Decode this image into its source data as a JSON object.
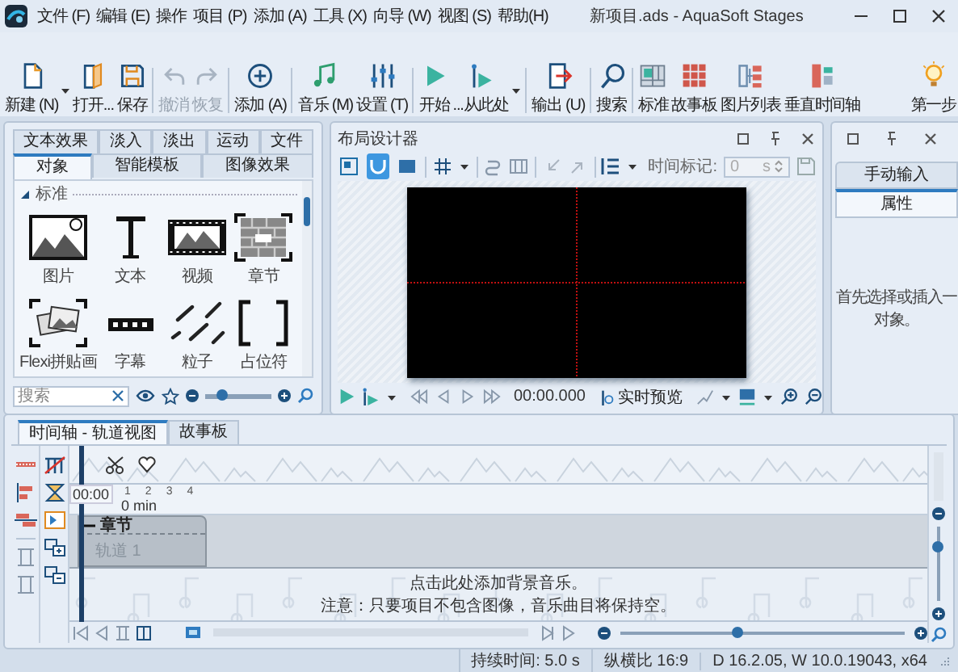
{
  "window": {
    "title": "新项目.ads - AquaSoft Stages"
  },
  "menu": [
    "文件 (F)",
    "编辑 (E)",
    "操作",
    "项目 (P)",
    "添加 (A)",
    "工具 (X)",
    "向导 (W)",
    "视图 (S)",
    "帮助(H)"
  ],
  "ribbon": {
    "buttons": [
      {
        "label": "新建 (N)",
        "disabled": false,
        "dropdown": true,
        "separator_before": false
      },
      {
        "label": "打开...",
        "disabled": false,
        "dropdown": false,
        "separator_before": false
      },
      {
        "label": "保存",
        "disabled": false,
        "dropdown": false,
        "separator_before": false
      },
      {
        "label": "撤消",
        "disabled": true,
        "dropdown": false,
        "separator_before": true
      },
      {
        "label": "恢复",
        "disabled": true,
        "dropdown": false,
        "separator_before": false
      },
      {
        "label": "添加 (A)",
        "disabled": false,
        "dropdown": false,
        "separator_before": true
      },
      {
        "label": "音乐 (M)",
        "disabled": false,
        "dropdown": false,
        "separator_before": true
      },
      {
        "label": "设置 (T)",
        "disabled": false,
        "dropdown": false,
        "separator_before": false
      },
      {
        "label": "开始",
        "disabled": false,
        "dropdown": false,
        "separator_before": true
      },
      {
        "label": "...从此处",
        "disabled": false,
        "dropdown": true,
        "separator_before": false
      },
      {
        "label": "输出 (U)",
        "disabled": false,
        "dropdown": false,
        "separator_before": true
      },
      {
        "label": "搜索",
        "disabled": false,
        "dropdown": false,
        "separator_before": true
      },
      {
        "label": "标准",
        "disabled": false,
        "dropdown": false,
        "separator_before": true
      },
      {
        "label": "故事板",
        "disabled": false,
        "dropdown": false,
        "separator_before": false
      },
      {
        "label": "图片列表",
        "disabled": false,
        "dropdown": false,
        "separator_before": false
      },
      {
        "label": "垂直时间轴",
        "disabled": false,
        "dropdown": false,
        "separator_before": false
      }
    ],
    "help_button": {
      "label": "第一步"
    }
  },
  "effects_panel": {
    "tab_rows": [
      [
        {
          "label": "文本效果",
          "selected": false
        },
        {
          "label": "淡入",
          "selected": false
        },
        {
          "label": "淡出",
          "selected": false
        },
        {
          "label": "运动",
          "selected": false
        },
        {
          "label": "文件",
          "selected": false
        }
      ],
      [
        {
          "label": "对象",
          "selected": true
        },
        {
          "label": "智能模板",
          "selected": false
        },
        {
          "label": "图像效果",
          "selected": false
        }
      ]
    ],
    "section": {
      "label": "标准",
      "expanded": true
    },
    "items": [
      {
        "label": "图片"
      },
      {
        "label": "文本"
      },
      {
        "label": "视频"
      },
      {
        "label": "章节"
      },
      {
        "label": "Flexi拼贴画"
      },
      {
        "label": "字幕"
      },
      {
        "label": "粒子"
      },
      {
        "label": "占位符"
      }
    ],
    "search": {
      "placeholder": "搜索"
    },
    "zoom": {
      "level": 0.25
    }
  },
  "layout_designer": {
    "title": "布局设计器",
    "tools": [
      {
        "selected": false
      },
      {
        "selected": true
      },
      {
        "selected": false
      }
    ],
    "time_marker": {
      "label": "时间标记:",
      "value": "0",
      "unit": "s",
      "disabled": true
    },
    "timecode": "00:00.000",
    "live_preview": "实时预览"
  },
  "properties_panel": {
    "tabs": [
      {
        "label": "手动输入",
        "selected": false
      },
      {
        "label": "属性",
        "selected": true
      }
    ],
    "message_lines": [
      "首先选择或插入一",
      "对象。"
    ]
  },
  "timeline": {
    "tabs": [
      {
        "label": "时间轴 - 轨道视图",
        "selected": true
      },
      {
        "label": "故事板",
        "selected": false
      }
    ],
    "playhead_time": "00:00",
    "ruler": {
      "unit": "0 min",
      "ticks": [
        "1",
        "2",
        "3",
        "4"
      ]
    },
    "chapter": {
      "label": "章节",
      "expanded": true
    },
    "track": "轨道 1",
    "music_hint": [
      "点击此处添加背景音乐。",
      "注意：只要项目不包含图像，音乐曲目将保持空。"
    ],
    "zoom": {
      "level": 0.41
    },
    "track_height": {
      "level": 0.75
    }
  },
  "status_bar": {
    "items": [
      "持续时间: 5.0 s",
      "纵横比 16:9",
      "D 16.2.05, W 10.0.19043, x64"
    ]
  }
}
